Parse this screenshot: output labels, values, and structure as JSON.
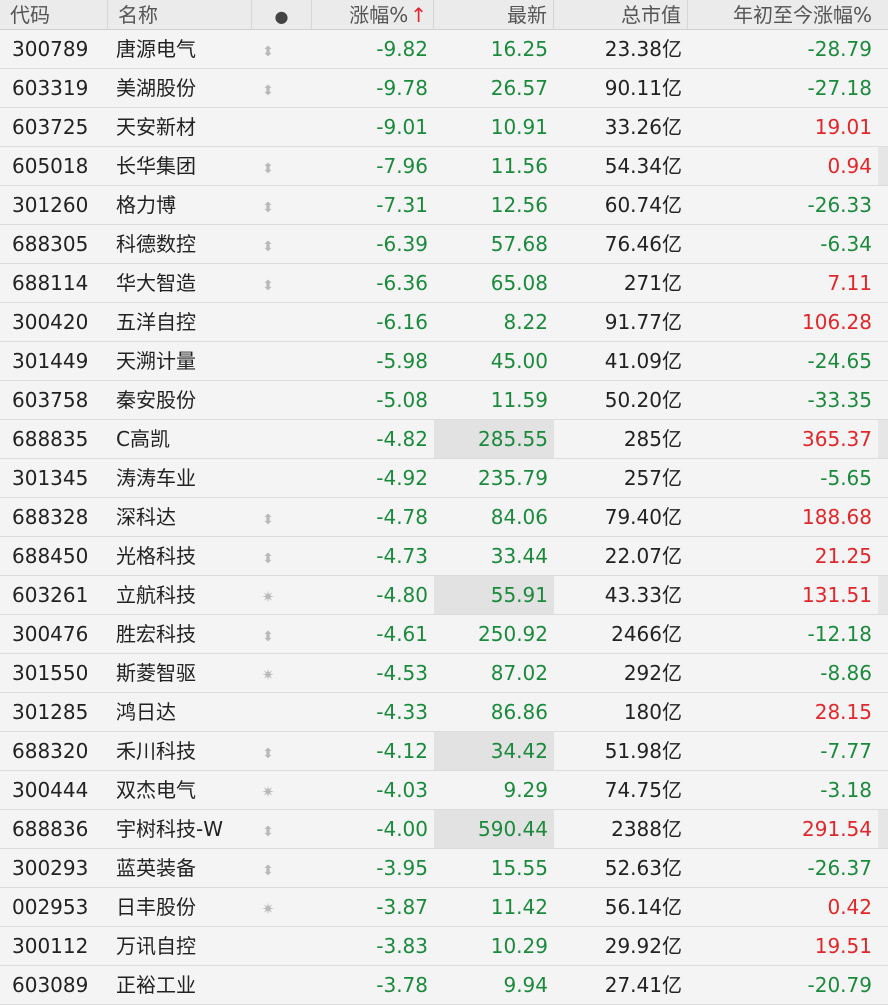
{
  "header": {
    "code": "代码",
    "name": "名称",
    "dot": "●",
    "change": "涨幅%",
    "sort_arrow": "↑",
    "last": "最新",
    "market_cap": "总市值",
    "ytd": "年初至今涨幅%"
  },
  "colors": {
    "down": "#1b8a3c",
    "up": "#e0272b"
  },
  "rows": [
    {
      "code": "300789",
      "name": "唐源电气",
      "icon": "updown-arrows-icon",
      "change": "-9.82",
      "last": "16.25",
      "cap": "23.38亿",
      "ytd": "-28.79",
      "ytd_dir": "down"
    },
    {
      "code": "603319",
      "name": "美湖股份",
      "icon": "updown-arrows-icon",
      "change": "-9.78",
      "last": "26.57",
      "cap": "90.11亿",
      "ytd": "-27.18",
      "ytd_dir": "down"
    },
    {
      "code": "603725",
      "name": "天安新材",
      "icon": "",
      "change": "-9.01",
      "last": "10.91",
      "cap": "33.26亿",
      "ytd": "19.01",
      "ytd_dir": "up"
    },
    {
      "code": "605018",
      "name": "长华集团",
      "icon": "updown-arrows-icon",
      "change": "-7.96",
      "last": "11.56",
      "cap": "54.34亿",
      "ytd": "0.94",
      "ytd_dir": "up"
    },
    {
      "code": "301260",
      "name": "格力博",
      "icon": "updown-arrows-icon",
      "change": "-7.31",
      "last": "12.56",
      "cap": "60.74亿",
      "ytd": "-26.33",
      "ytd_dir": "down"
    },
    {
      "code": "688305",
      "name": "科德数控",
      "icon": "updown-arrows-icon",
      "change": "-6.39",
      "last": "57.68",
      "cap": "76.46亿",
      "ytd": "-6.34",
      "ytd_dir": "down"
    },
    {
      "code": "688114",
      "name": "华大智造",
      "icon": "updown-arrows-icon",
      "change": "-6.36",
      "last": "65.08",
      "cap": "271亿",
      "ytd": "7.11",
      "ytd_dir": "up"
    },
    {
      "code": "300420",
      "name": "五洋自控",
      "icon": "",
      "change": "-6.16",
      "last": "8.22",
      "cap": "91.77亿",
      "ytd": "106.28",
      "ytd_dir": "up"
    },
    {
      "code": "301449",
      "name": "天溯计量",
      "icon": "",
      "change": "-5.98",
      "last": "45.00",
      "cap": "41.09亿",
      "ytd": "-24.65",
      "ytd_dir": "down"
    },
    {
      "code": "603758",
      "name": "秦安股份",
      "icon": "",
      "change": "-5.08",
      "last": "11.59",
      "cap": "50.20亿",
      "ytd": "-33.35",
      "ytd_dir": "down"
    },
    {
      "code": "688835",
      "name": "C高凯",
      "icon": "",
      "change": "-4.82",
      "last": "285.55",
      "cap": "285亿",
      "ytd": "365.37",
      "ytd_dir": "up"
    },
    {
      "code": "301345",
      "name": "涛涛车业",
      "icon": "",
      "change": "-4.92",
      "last": "235.79",
      "cap": "257亿",
      "ytd": "-5.65",
      "ytd_dir": "down"
    },
    {
      "code": "688328",
      "name": "深科达",
      "icon": "updown-arrows-icon",
      "change": "-4.78",
      "last": "84.06",
      "cap": "79.40亿",
      "ytd": "188.68",
      "ytd_dir": "up"
    },
    {
      "code": "688450",
      "name": "光格科技",
      "icon": "updown-arrows-icon",
      "change": "-4.73",
      "last": "33.44",
      "cap": "22.07亿",
      "ytd": "21.25",
      "ytd_dir": "up"
    },
    {
      "code": "603261",
      "name": "立航科技",
      "icon": "star-icon",
      "change": "-4.80",
      "last": "55.91",
      "cap": "43.33亿",
      "ytd": "131.51",
      "ytd_dir": "up"
    },
    {
      "code": "300476",
      "name": "胜宏科技",
      "icon": "updown-arrows-icon",
      "change": "-4.61",
      "last": "250.92",
      "cap": "2466亿",
      "ytd": "-12.18",
      "ytd_dir": "down"
    },
    {
      "code": "301550",
      "name": "斯菱智驱",
      "icon": "star-icon",
      "change": "-4.53",
      "last": "87.02",
      "cap": "292亿",
      "ytd": "-8.86",
      "ytd_dir": "down"
    },
    {
      "code": "301285",
      "name": "鸿日达",
      "icon": "",
      "change": "-4.33",
      "last": "86.86",
      "cap": "180亿",
      "ytd": "28.15",
      "ytd_dir": "up"
    },
    {
      "code": "688320",
      "name": "禾川科技",
      "icon": "updown-arrows-icon",
      "change": "-4.12",
      "last": "34.42",
      "cap": "51.98亿",
      "ytd": "-7.77",
      "ytd_dir": "down"
    },
    {
      "code": "300444",
      "name": "双杰电气",
      "icon": "star-icon",
      "change": "-4.03",
      "last": "9.29",
      "cap": "74.75亿",
      "ytd": "-3.18",
      "ytd_dir": "down"
    },
    {
      "code": "688836",
      "name": "宇树科技-W",
      "icon": "updown-arrows-icon",
      "change": "-4.00",
      "last": "590.44",
      "cap": "2388亿",
      "ytd": "291.54",
      "ytd_dir": "up"
    },
    {
      "code": "300293",
      "name": "蓝英装备",
      "icon": "updown-arrows-icon",
      "change": "-3.95",
      "last": "15.55",
      "cap": "52.63亿",
      "ytd": "-26.37",
      "ytd_dir": "down"
    },
    {
      "code": "002953",
      "name": "日丰股份",
      "icon": "star-icon",
      "change": "-3.87",
      "last": "11.42",
      "cap": "56.14亿",
      "ytd": "0.42",
      "ytd_dir": "up"
    },
    {
      "code": "300112",
      "name": "万讯自控",
      "icon": "",
      "change": "-3.83",
      "last": "10.29",
      "cap": "29.92亿",
      "ytd": "19.51",
      "ytd_dir": "up"
    },
    {
      "code": "603089",
      "name": "正裕工业",
      "icon": "",
      "change": "-3.78",
      "last": "9.94",
      "cap": "27.41亿",
      "ytd": "-20.79",
      "ytd_dir": "down"
    }
  ]
}
